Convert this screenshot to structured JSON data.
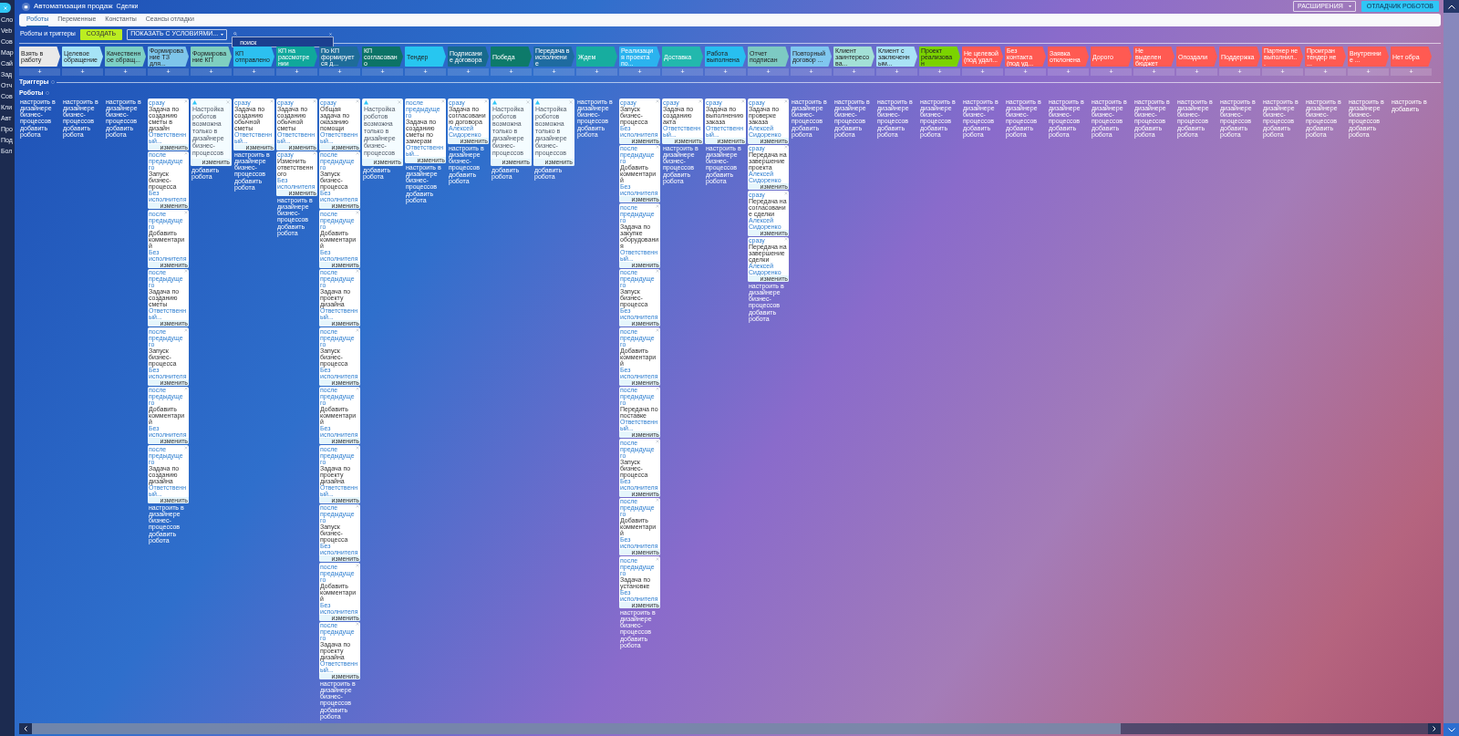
{
  "sidebar": {
    "items": [
      "Сло",
      "Veb",
      "Сов",
      "Мар",
      "Сай",
      "Зад",
      "Отч",
      "Сов",
      "Кли",
      "Авт",
      "Про",
      "Под",
      "Бол"
    ]
  },
  "header": {
    "title": "Автоматизация продаж",
    "entity": "Сделки",
    "extensions": "РАСШИРЕНИЯ",
    "debugger": "ОТЛАДЧИК РОБОТОВ"
  },
  "tabs": [
    {
      "label": "Роботы",
      "selected": true
    },
    {
      "label": "Переменные",
      "selected": false
    },
    {
      "label": "Константы",
      "selected": false
    },
    {
      "label": "Сеансы отладки",
      "selected": false
    }
  ],
  "toolbar": {
    "title": "Роботы и триггеры",
    "create": "СОЗДАТЬ",
    "filter": "ПОКАЗАТЬ С УСЛОВИЯМИ...",
    "search": {
      "placeholder": "поиск"
    }
  },
  "sections": {
    "triggers": "Триггеры",
    "robots": "Роботы"
  },
  "stages": [
    {
      "title": "Взять в работу",
      "color": "#e9e9e9",
      "add": "+",
      "links": [
        "настроить в дизайнере бизнес-процессов",
        "добавить робота"
      ]
    },
    {
      "title": "Целевое обращение",
      "color": "#a6e4f7",
      "add": "+",
      "links": [
        "настроить в дизайнере бизнес-процессов",
        "добавить робота"
      ]
    },
    {
      "title": "Качественное обращ...",
      "color": "#7dd0c5",
      "add": "+",
      "links": [
        "настроить в дизайнере бизнес-процессов",
        "добавить робота"
      ]
    },
    {
      "title": "Формирование ТЗ для...",
      "color": "#7ec5ea",
      "add": "+",
      "robots": [
        {
          "kind": "robot",
          "delay": "сразу",
          "title": "Задача по созданию сметы в дизайн",
          "responsible": "Ответственный...",
          "edit": "изменить"
        },
        {
          "kind": "robot",
          "delay": "после предыдущего",
          "title": "Запуск бизнес-процесса",
          "responsible": "Без исполнителя",
          "edit": "изменить"
        },
        {
          "kind": "robot",
          "delay": "после предыдущего",
          "title": "Добавить комментарий",
          "responsible": "Без исполнителя",
          "edit": "изменить"
        },
        {
          "kind": "robot",
          "delay": "после предыдущего",
          "title": "Задача по созданию сметы",
          "responsible": "Ответственный...",
          "edit": "изменить"
        },
        {
          "kind": "robot",
          "delay": "после предыдущего",
          "title": "Запуск бизнес-процесса",
          "responsible": "Без исполнителя",
          "edit": "изменить"
        },
        {
          "kind": "robot",
          "delay": "после предыдущего",
          "title": "Добавить комментарий",
          "responsible": "Без исполнителя",
          "edit": "изменить"
        },
        {
          "kind": "robot",
          "delay": "после предыдущего",
          "title": "Задача по созданию дизайна",
          "responsible": "Ответственный...",
          "edit": "изменить"
        }
      ],
      "links": [
        "настроить в дизайнере бизнес-процессов",
        "добавить робота"
      ]
    },
    {
      "title": "Формирование КП",
      "color": "#7fcfc0",
      "add": "+",
      "robots": [
        {
          "kind": "warning",
          "title": "Настройка роботов возможна только в дизайнере бизнес-процессов",
          "edit": "изменить"
        }
      ],
      "links": [
        "добавить робота"
      ]
    },
    {
      "title": "КП отправлено",
      "color": "#2cc0f0",
      "add": "+",
      "robots": [
        {
          "kind": "robot",
          "delay": "сразу",
          "title": "Задача по созданию обычной сметы",
          "responsible": "Ответственный...",
          "edit": "изменить"
        }
      ],
      "links": [
        "настроить в дизайнере бизнес-процессов",
        "добавить робота"
      ]
    },
    {
      "title": "КП на рассмотрении",
      "color": "#10a89b",
      "add": "+",
      "robots": [
        {
          "kind": "robot",
          "delay": "сразу",
          "title": "Задача по созданию обычной сметы",
          "responsible": "Ответственный...",
          "edit": "изменить"
        },
        {
          "kind": "robot",
          "delay": "сразу",
          "title": "Изменить ответственного",
          "responsible": "Без исполнителя",
          "edit": "изменить"
        }
      ],
      "links": [
        "настроить в дизайнере бизнес-процессов",
        "добавить робота"
      ]
    },
    {
      "title": "По КП формируется д...",
      "color": "#1e6c99",
      "add": "+",
      "robots": [
        {
          "kind": "robot",
          "delay": "сразу",
          "title": "Общая задача по оказанию помощи",
          "responsible": "Ответственный...",
          "edit": "изменить"
        },
        {
          "kind": "robot",
          "delay": "после предыдущего",
          "title": "Запуск бизнес-процесса",
          "responsible": "Без исполнителя",
          "edit": "изменить"
        },
        {
          "kind": "robot",
          "delay": "после предыдущего",
          "title": "Добавить комментарий",
          "responsible": "Без исполнителя",
          "edit": "изменить"
        },
        {
          "kind": "robot",
          "delay": "после предыдущего",
          "title": "Задача по проекту дизайна",
          "responsible": "Ответственный...",
          "edit": "изменить"
        },
        {
          "kind": "robot",
          "delay": "после предыдущего",
          "title": "Запуск бизнес-процесса",
          "responsible": "Без исполнителя",
          "edit": "изменить"
        },
        {
          "kind": "robot",
          "delay": "после предыдущего",
          "title": "Добавить комментарий",
          "responsible": "Без исполнителя",
          "edit": "изменить"
        },
        {
          "kind": "robot",
          "delay": "после предыдущего",
          "title": "Задача по проекту дизайна",
          "responsible": "Ответственный...",
          "edit": "изменить"
        },
        {
          "kind": "robot",
          "delay": "после предыдущего",
          "title": "Запуск бизнес-процесса",
          "responsible": "Без исполнителя",
          "edit": "изменить"
        },
        {
          "kind": "robot",
          "delay": "после предыдущего",
          "title": "Добавить комментарий",
          "responsible": "Без исполнителя",
          "edit": "изменить"
        },
        {
          "kind": "robot",
          "delay": "после предыдущего",
          "title": "Задача по проекту дизайна",
          "responsible": "Ответственный...",
          "edit": "изменить"
        }
      ],
      "links": [
        "настроить в дизайнере бизнес-процессов",
        "добавить робота"
      ]
    },
    {
      "title": "КП согласовано",
      "color": "#0c7366",
      "add": "+",
      "robots": [
        {
          "kind": "warning",
          "title": "Настройка роботов возможна только в дизайнере бизнес-процессов",
          "edit": "изменить"
        }
      ],
      "links": [
        "добавить робота"
      ]
    },
    {
      "title": "Тендер",
      "color": "#27c6f0",
      "add": "+",
      "robots": [
        {
          "kind": "robot",
          "delay": "после предыдущего",
          "title": "Задача по созданию сметы по замерам",
          "responsible": "Ответственный...",
          "edit": "изменить"
        }
      ],
      "links": [
        "настроить в дизайнере бизнес-процессов",
        "добавить робота"
      ]
    },
    {
      "title": "Подписание договора",
      "color": "#176a8c",
      "add": "+",
      "robots": [
        {
          "kind": "robot",
          "delay": "сразу",
          "title": "Задача по согласованию договора",
          "responsible": "Алексей Сидоренко",
          "edit": "изменить"
        }
      ],
      "links": [
        "настроить в дизайнере бизнес-процессов",
        "добавить робота"
      ]
    },
    {
      "title": "Победа",
      "color": "#0d7a6a",
      "add": "+",
      "robots": [
        {
          "kind": "warning",
          "title": "Настройка роботов возможна только в дизайнере бизнес-процессов",
          "edit": "изменить"
        }
      ],
      "links": [
        "добавить робота"
      ]
    },
    {
      "title": "Передача в исполнение",
      "color": "#1e6ba0",
      "add": "+",
      "robots": [
        {
          "kind": "warning",
          "title": "Настройка роботов возможна только в дизайнере бизнес-процессов",
          "edit": "изменить"
        }
      ],
      "links": [
        "добавить робота"
      ]
    },
    {
      "title": "Ждем",
      "color": "#17ad9f",
      "add": "+",
      "links": [
        "настроить в дизайнере бизнес-процессов",
        "добавить робота"
      ]
    },
    {
      "title": "Реализация проекта по...",
      "color": "#2bb3ef",
      "add": "+",
      "robots": [
        {
          "kind": "robot",
          "delay": "сразу",
          "title": "Запуск бизнес-процесса",
          "responsible": "Без исполнителя",
          "edit": "изменить"
        },
        {
          "kind": "robot",
          "delay": "после предыдущего",
          "title": "Добавить комментарий",
          "responsible": "Без исполнителя",
          "edit": "изменить"
        },
        {
          "kind": "robot",
          "delay": "после предыдущего",
          "title": "Задача по закупке оборудования",
          "responsible": "Ответственный...",
          "edit": "изменить"
        },
        {
          "kind": "robot",
          "delay": "после предыдущего",
          "title": "Запуск бизнес-процесса",
          "responsible": "Без исполнителя",
          "edit": "изменить"
        },
        {
          "kind": "robot",
          "delay": "после предыдущего",
          "title": "Добавить комментарий",
          "responsible": "Без исполнителя",
          "edit": "изменить"
        },
        {
          "kind": "robot",
          "delay": "после предыдущего",
          "title": "Передача по поставке",
          "responsible": "Ответственный...",
          "edit": "изменить"
        },
        {
          "kind": "robot",
          "delay": "после предыдущего",
          "title": "Запуск бизнес-процесса",
          "responsible": "Без исполнителя",
          "edit": "изменить"
        },
        {
          "kind": "robot",
          "delay": "после предыдущего",
          "title": "Добавить комментарий",
          "responsible": "Без исполнителя",
          "edit": "изменить"
        },
        {
          "kind": "robot",
          "delay": "после предыдущего",
          "title": "Задача по установке",
          "responsible": "Без исполнителя",
          "edit": "изменить"
        }
      ],
      "links": [
        "настроить в дизайнере бизнес-процессов",
        "добавить робота"
      ]
    },
    {
      "title": "Доставка",
      "color": "#22b8ad",
      "add": "+",
      "robots": [
        {
          "kind": "robot",
          "delay": "сразу",
          "title": "Задача по созданию акта",
          "responsible": "Ответственный...",
          "edit": "изменить"
        }
      ],
      "links": [
        "настроить в дизайнере бизнес-процессов",
        "добавить робота"
      ]
    },
    {
      "title": "Работа выполнена",
      "color": "#28bff0",
      "add": "+",
      "robots": [
        {
          "kind": "robot",
          "delay": "сразу",
          "title": "Задача по выполнению заказа",
          "responsible": "Ответственный...",
          "edit": "изменить"
        }
      ],
      "links": [
        "настроить в дизайнере бизнес-процессов",
        "добавить робота"
      ]
    },
    {
      "title": "Отчет подписан",
      "color": "#7dcac3",
      "add": "+",
      "robots": [
        {
          "kind": "robot",
          "delay": "сразу",
          "title": "Задача по проверке заказа",
          "responsible": "Алексей Сидоренко",
          "edit": "изменить"
        },
        {
          "kind": "robot",
          "delay": "сразу",
          "title": "Передача на завершение проекта",
          "responsible": "Алексей Сидоренко",
          "edit": "изменить"
        },
        {
          "kind": "robot",
          "delay": "сразу",
          "title": "Передача на согласование сделки",
          "responsible": "Алексей Сидоренко",
          "edit": "изменить"
        },
        {
          "kind": "robot",
          "delay": "сразу",
          "title": "Передача на завершение сделки",
          "responsible": "Алексей Сидоренко",
          "edit": "изменить"
        }
      ],
      "links": [
        "настроить в дизайнере бизнес-процессов",
        "добавить робота"
      ]
    },
    {
      "title": "Повторный договор ...",
      "color": "#80c7ef",
      "add": "+",
      "links": [
        "настроить в дизайнере бизнес-процессов",
        "добавить робота"
      ]
    },
    {
      "title": "Клиент заинтересова...",
      "color": "#a3e0d6",
      "add": "+",
      "links": [
        "настроить в дизайнере бизнес-процессов",
        "добавить робота"
      ]
    },
    {
      "title": "Клиент с заключенным...",
      "color": "#a9e2f5",
      "add": "+",
      "links": [
        "настроить в дизайнере бизнес-процессов",
        "добавить робота"
      ]
    },
    {
      "title": "Проект реализован",
      "color": "#7bd300",
      "add": "+",
      "links": [
        "настроить в дизайнере бизнес-процессов",
        "добавить робота"
      ]
    },
    {
      "title": "Не целевой (под удал...",
      "color": "#ff5a52",
      "add": "+",
      "links": [
        "настроить в дизайнере бизнес-процессов",
        "добавить робота"
      ]
    },
    {
      "title": "Без контакта (под уд...",
      "color": "#ff5a52",
      "add": "+",
      "links": [
        "настроить в дизайнере бизнес-процессов",
        "добавить робота"
      ]
    },
    {
      "title": "Заявка отклонена",
      "color": "#ff5a52",
      "add": "+",
      "links": [
        "настроить в дизайнере бизнес-процессов",
        "добавить робота"
      ]
    },
    {
      "title": "Дорого",
      "color": "#ff5a52",
      "add": "+",
      "links": [
        "настроить в дизайнере бизнес-процессов",
        "добавить робота"
      ]
    },
    {
      "title": "Не выделен бюджет",
      "color": "#ff5a52",
      "add": "+",
      "links": [
        "настроить в дизайнере бизнес-процессов",
        "добавить робота"
      ]
    },
    {
      "title": "Опоздали",
      "color": "#ff5a52",
      "add": "+",
      "links": [
        "настроить в дизайнере бизнес-процессов",
        "добавить робота"
      ]
    },
    {
      "title": "Поддержка",
      "color": "#ff5a52",
      "add": "+",
      "links": [
        "настроить в дизайнере бизнес-процессов",
        "добавить робота"
      ]
    },
    {
      "title": "Партнер не выполнил...",
      "color": "#ff5a52",
      "add": "+",
      "links": [
        "настроить в дизайнере бизнес-процессов",
        "добавить робота"
      ]
    },
    {
      "title": "Проигран тендер не ...",
      "color": "#ff5a52",
      "add": "+",
      "links": [
        "настроить в дизайнере бизнес-процессов",
        "добавить робота"
      ]
    },
    {
      "title": "Внутренние ...",
      "color": "#ff5a52",
      "add": "+",
      "links": [
        "настроить в дизайнере бизнес-процессов",
        "добавить робота"
      ]
    },
    {
      "title": "Нет обра",
      "color": "#ff5a52",
      "add": "+",
      "links": [
        "настроить в",
        "добавить"
      ]
    }
  ]
}
